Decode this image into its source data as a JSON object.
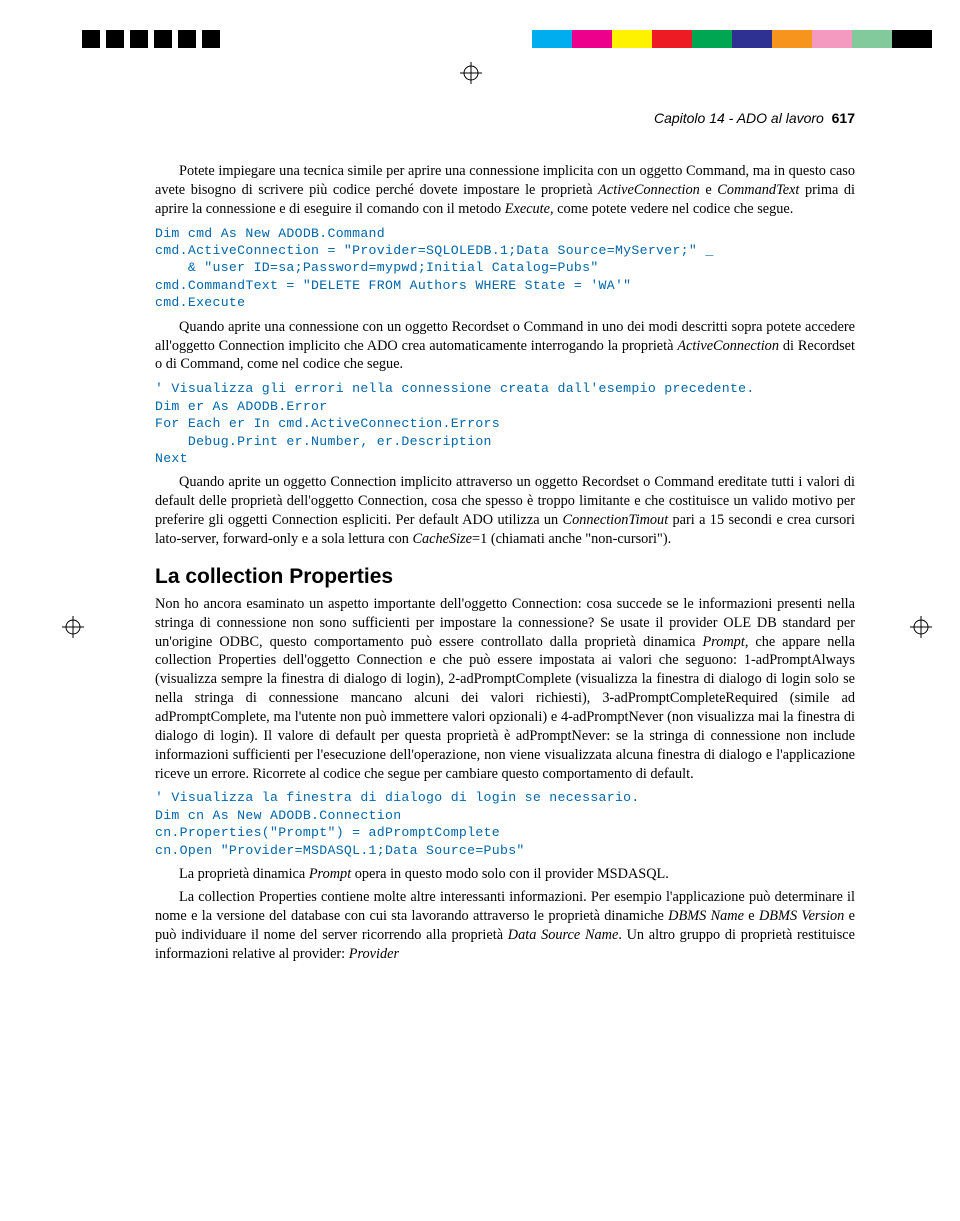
{
  "header": {
    "chapter": "Capitolo 14 - ADO al lavoro",
    "page": "617"
  },
  "paragraphs": {
    "p1_a": "Potete impiegare una tecnica simile per aprire una connessione implicita con un oggetto Command, ma in questo caso avete bisogno di scrivere più codice perché dovete impostare le proprietà ",
    "p1_i1": "ActiveConnection",
    "p1_b": " e ",
    "p1_i2": "CommandText",
    "p1_c": " prima di aprire la connessione e di eseguire il comando con il metodo ",
    "p1_i3": "Execute",
    "p1_d": ", come potete vedere nel codice che segue.",
    "p2_a": "Quando aprite una connessione con un oggetto Recordset o Command in uno dei modi descritti sopra potete accedere all'oggetto Connection implicito che ADO crea automaticamente interrogando la proprietà ",
    "p2_i1": "ActiveConnection",
    "p2_b": " di Recordset o di Command, come nel codice che segue.",
    "p3_a": "Quando aprite un oggetto Connection implicito attraverso un oggetto Recordset o Command ereditate tutti i valori di default delle proprietà dell'oggetto Connection, cosa che spesso è troppo limitante e che costituisce un valido motivo per preferire gli oggetti Connection espliciti. Per default ADO utilizza un ",
    "p3_i1": "ConnectionTimout",
    "p3_b": " pari a 15 secondi e crea cursori lato-server, forward-only e a sola lettura con ",
    "p3_i2": "CacheSize",
    "p3_c": "=1 (chiamati anche \"non-cursori\").",
    "p4": "Non ho ancora esaminato un aspetto importante dell'oggetto Connection: cosa succede se le informazioni presenti nella stringa di connessione non sono sufficienti per impostare la connessione? Se usate il provider OLE DB standard per un'origine ODBC, questo comportamento può essere controllato dalla proprietà dinamica ",
    "p4_i1": "Prompt",
    "p4_b": ", che appare nella collection Properties dell'oggetto Connection e che può essere impostata ai valori che seguono: 1-adPromptAlways (visualizza sempre la finestra di dialogo di login), 2-adPromptComplete (visualizza la finestra di dialogo di login solo se nella stringa di connessione mancano alcuni dei valori richiesti), 3-adPromptCompleteRequired (simile ad adPromptComplete, ma l'utente non può immettere valori opzionali) e 4-adPromptNever (non visualizza mai la finestra di dialogo di login). Il valore di default per questa proprietà è adPromptNever: se la stringa di connessione non include informazioni sufficienti per l'esecuzione dell'operazione, non viene visualizzata alcuna finestra di dialogo e l'applicazione riceve un errore. Ricorrete al codice che segue per cambiare questo comportamento di default.",
    "p5_a": "La proprietà dinamica ",
    "p5_i1": "Prompt",
    "p5_b": " opera in questo modo solo con il provider MSDASQL.",
    "p6_a": "La collection Properties contiene molte altre interessanti informazioni. Per esempio l'applicazione può determinare il nome e la versione del database con cui sta lavorando attraverso le proprietà dinamiche ",
    "p6_i1": "DBMS Name",
    "p6_b": " e ",
    "p6_i2": "DBMS Version",
    "p6_c": " e può individuare il nome del server ricorrendo alla proprietà ",
    "p6_i3": "Data Source Name",
    "p6_d": ". Un altro gruppo di proprietà restituisce informazioni relative al provider: ",
    "p6_i4": "Provider"
  },
  "code": {
    "c1": "Dim cmd As New ADODB.Command\ncmd.ActiveConnection = \"Provider=SQLOLEDB.1;Data Source=MyServer;\" _\n    & \"user ID=sa;Password=mypwd;Initial Catalog=Pubs\"\ncmd.CommandText = \"DELETE FROM Authors WHERE State = 'WA'\"\ncmd.Execute",
    "c2": "' Visualizza gli errori nella connessione creata dall'esempio precedente.\nDim er As ADODB.Error\nFor Each er In cmd.ActiveConnection.Errors\n    Debug.Print er.Number, er.Description\nNext",
    "c3": "' Visualizza la finestra di dialogo di login se necessario.\nDim cn As New ADODB.Connection\ncn.Properties(\"Prompt\") = adPromptComplete\ncn.Open \"Provider=MSDASQL.1;Data Source=Pubs\""
  },
  "heading": "La collection Properties",
  "colors": {
    "left": [
      "#000",
      "#000",
      "#000",
      "#000",
      "#000",
      "#000"
    ],
    "right": [
      "#00aeef",
      "#ec008c",
      "#fff200",
      "#ed1c24",
      "#00a651",
      "#2e3192",
      "#f7941d",
      "#f49ac1",
      "#82ca9c",
      "#000"
    ]
  }
}
